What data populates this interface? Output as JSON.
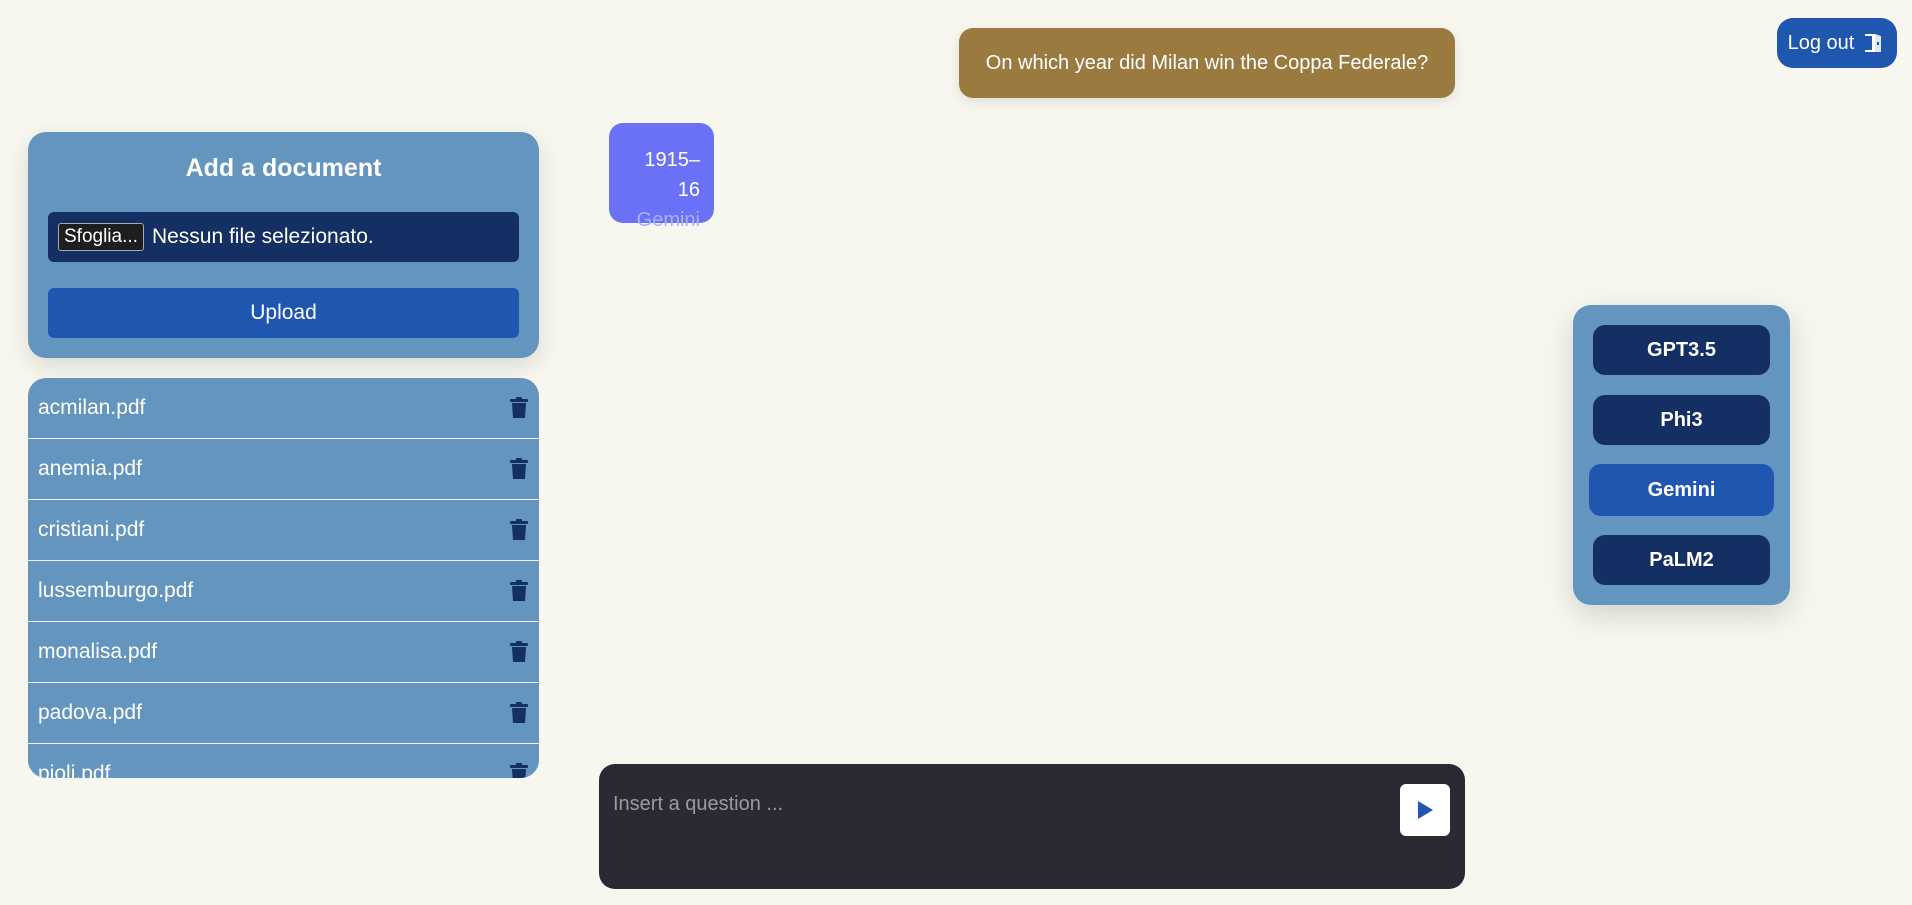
{
  "header": {
    "logout_label": "Log out",
    "logout_icon": "door-exit-icon"
  },
  "upload": {
    "title": "Add a document",
    "browse_label": "Sfoglia...",
    "no_file_label": "Nessun file selezionato.",
    "upload_label": "Upload"
  },
  "files": [
    "acmilan.pdf",
    "anemia.pdf",
    "cristiani.pdf",
    "lussemburgo.pdf",
    "monalisa.pdf",
    "padova.pdf",
    "pioli.pdf"
  ],
  "chat": {
    "user_message": "On which year did Milan win the Coppa Federale?",
    "bot_answer": "1915–16",
    "bot_model": "Gemini"
  },
  "models": {
    "options": [
      "GPT3.5",
      "Phi3",
      "Gemini",
      "PaLM2"
    ],
    "selected": "Gemini"
  },
  "input": {
    "placeholder": "Insert a question ...",
    "send_icon": "play-icon"
  },
  "colors": {
    "background": "#f7f7f0",
    "panel": "#6495be",
    "dark_button": "#142f63",
    "accent": "#1e56b0",
    "user_bubble": "#9a7a3f",
    "bot_bubble": "#6a71f7",
    "input_bg": "#2b2a33"
  }
}
